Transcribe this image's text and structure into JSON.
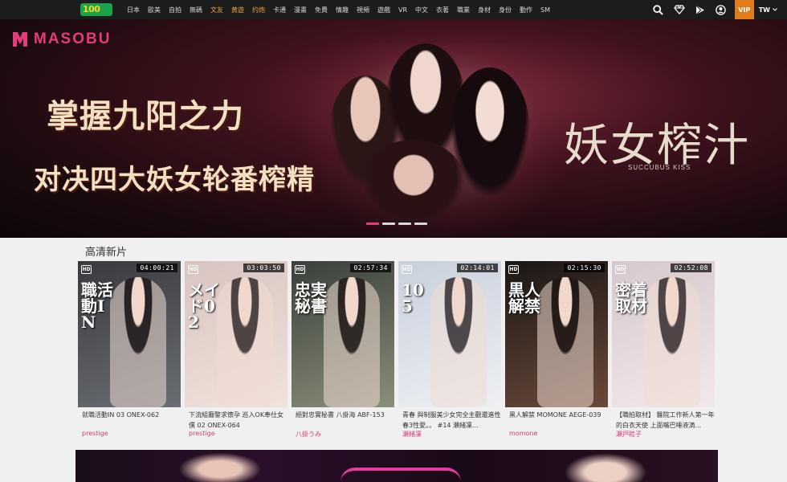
{
  "header": {
    "logo_text": "100",
    "nav": [
      {
        "label": "日本",
        "highlight": false
      },
      {
        "label": "歐美",
        "highlight": false
      },
      {
        "label": "自拍",
        "highlight": false
      },
      {
        "label": "無碼",
        "highlight": false
      },
      {
        "label": "文友",
        "highlight": true
      },
      {
        "label": "黄遊",
        "highlight": true
      },
      {
        "label": "约炮",
        "highlight": true
      },
      {
        "label": "卡通",
        "highlight": false
      },
      {
        "label": "漫畫",
        "highlight": false
      },
      {
        "label": "免費",
        "highlight": false
      },
      {
        "label": "情趣",
        "highlight": false
      },
      {
        "label": "視頻",
        "highlight": false
      },
      {
        "label": "遊戲",
        "highlight": false
      },
      {
        "label": "VR",
        "highlight": false
      },
      {
        "label": "中文",
        "highlight": false
      },
      {
        "label": "衣著",
        "highlight": false
      },
      {
        "label": "職業",
        "highlight": false
      },
      {
        "label": "身材",
        "highlight": false
      },
      {
        "label": "身份",
        "highlight": false
      },
      {
        "label": "動作",
        "highlight": false
      },
      {
        "label": "SM",
        "highlight": false
      }
    ],
    "vip_label": "VIP",
    "lang_label": "TW",
    "highlight_color": "#e8a43c",
    "vip_color": "#e27b1a"
  },
  "hero": {
    "brand": "MASOBU",
    "headline_1": "掌握九阳之力",
    "headline_2": "对决四大妖女轮番榨精",
    "title_right": "妖女榨汁",
    "subtitle_right": "SUCCUBUS KISS",
    "slide_count": 4,
    "active_slide": 0,
    "accent_color": "#e43c7a"
  },
  "section": {
    "title": "高清新片",
    "cards": [
      {
        "badge": "HD",
        "duration": "04:00:21",
        "title": "就職活動IN 03 ONEX-062",
        "actor": "prestige",
        "overlay": "職活動IN",
        "bg": [
          "#3a3a3e",
          "#6a6e74"
        ]
      },
      {
        "badge": "HD",
        "duration": "03:03:50",
        "title": "下流組廳警求懷孕 巡入OK奉仕女僕 02 ONEX-064",
        "actor": "prestige",
        "overlay": "メイド02",
        "bg": [
          "#d8c4c0",
          "#f0e2dc"
        ]
      },
      {
        "badge": "HD",
        "duration": "02:57:34",
        "title": "絕對忠實秘書 八掛海 ABF-153",
        "actor": "八掛うみ",
        "overlay": "忠実秘書",
        "bg": [
          "#3a3f3a",
          "#8a8f7a"
        ]
      },
      {
        "badge": "HD",
        "duration": "02:14:01",
        "title": "青春 與制服美少女完全主觀還進性春3性愛。。 #14 瀨緒凜...",
        "actor": "瀬緒凜",
        "overlay": "105",
        "bg": [
          "#c8d0dc",
          "#eef0f4"
        ]
      },
      {
        "badge": "HD",
        "duration": "02:15:30",
        "title": "黑人解禁 MOMONE AEGE-039",
        "actor": "momone",
        "overlay": "黒人解禁",
        "bg": [
          "#1a1614",
          "#6a4a3a"
        ]
      },
      {
        "badge": "HD",
        "duration": "02:52:08",
        "title": "【職拍取材】 醫院工作新人第一年的白衣天使 上面嘴巴唾液滴...",
        "actor": "瀬戸睦子",
        "overlay": "密着取材",
        "bg": [
          "#d6c8cc",
          "#f2e8ea"
        ]
      }
    ]
  }
}
